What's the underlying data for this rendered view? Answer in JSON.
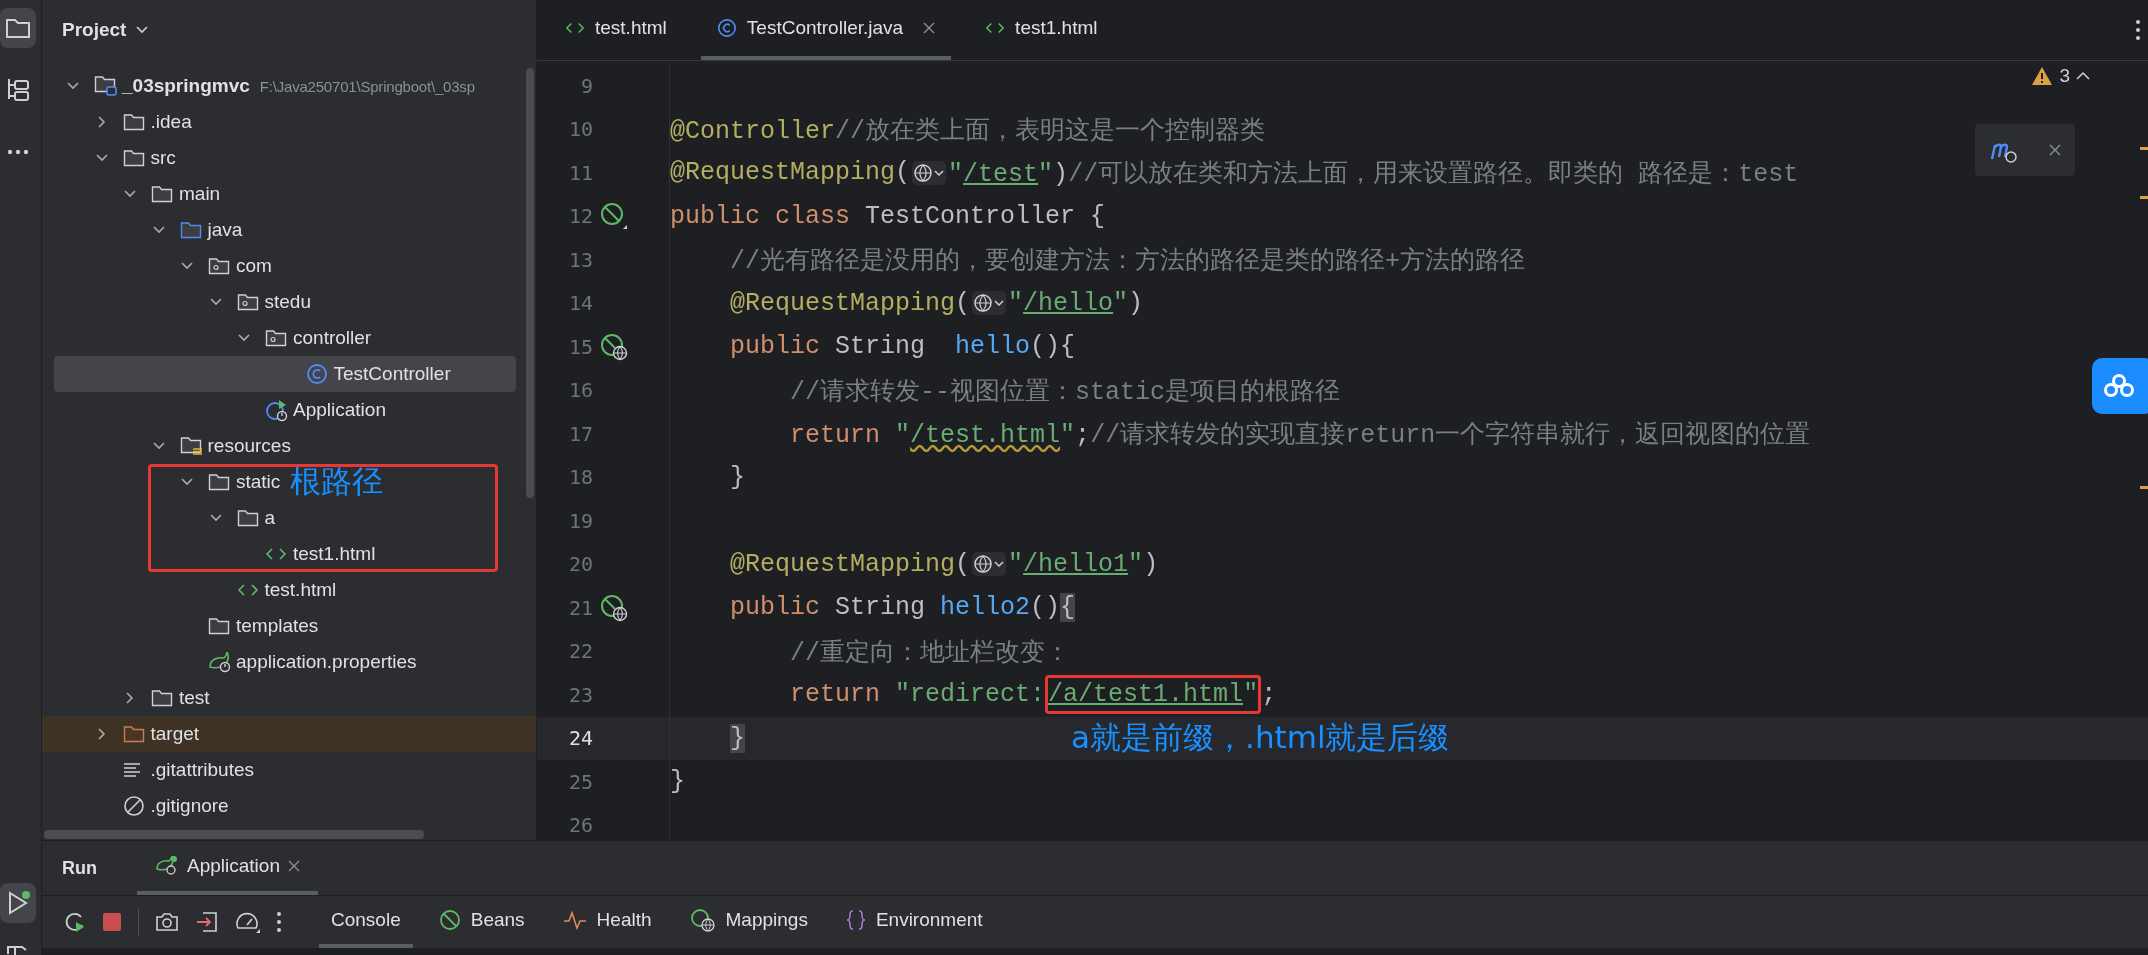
{
  "tool_strip": [
    {
      "kind": "project",
      "selected": true
    },
    {
      "kind": "structure",
      "selected": false
    },
    {
      "kind": "more",
      "selected": false
    }
  ],
  "tool_strip_bottom": [
    {
      "kind": "run",
      "selected": true
    },
    {
      "kind": "build",
      "selected": false
    }
  ],
  "project_panel": {
    "title": "Project",
    "tree": [
      {
        "kind": "module",
        "name": "_03springmvc",
        "path": "F:\\Java250701\\Springboot\\_03sp",
        "expanded": true,
        "selected": false,
        "children": [
          {
            "kind": "folder",
            "name": ".idea",
            "expanded": false,
            "selected": false
          },
          {
            "kind": "folder",
            "name": "src",
            "expanded": true,
            "selected": false,
            "children": [
              {
                "kind": "folder",
                "name": "main",
                "expanded": true,
                "selected": false,
                "children": [
                  {
                    "kind": "source",
                    "name": "java",
                    "expanded": true,
                    "selected": false,
                    "children": [
                      {
                        "kind": "package",
                        "name": "com",
                        "expanded": true,
                        "selected": false,
                        "children": [
                          {
                            "kind": "package",
                            "name": "stedu",
                            "expanded": true,
                            "selected": false,
                            "children": [
                              {
                                "kind": "package",
                                "name": "controller",
                                "expanded": true,
                                "selected": false,
                                "children": [
                                  {
                                    "kind": "class",
                                    "name": "TestController",
                                    "selected": true
                                  }
                                ]
                              },
                              {
                                "kind": "spring-app",
                                "name": "Application",
                                "selected": false
                              }
                            ]
                          }
                        ]
                      }
                    ]
                  },
                  {
                    "kind": "resources",
                    "name": "resources",
                    "expanded": true,
                    "selected": false,
                    "children": [
                      {
                        "kind": "folder",
                        "name": "static",
                        "expanded": true,
                        "selected": false,
                        "boxed": true,
                        "note": "根路径",
                        "children": [
                          {
                            "kind": "folder",
                            "name": "a",
                            "expanded": true,
                            "selected": false,
                            "boxed": true,
                            "children": [
                              {
                                "kind": "html",
                                "name": "test1.html",
                                "selected": false,
                                "boxed": true
                              }
                            ]
                          },
                          {
                            "kind": "html",
                            "name": "test.html",
                            "selected": false
                          }
                        ]
                      },
                      {
                        "kind": "folder",
                        "name": "templates",
                        "selected": false
                      },
                      {
                        "kind": "spring-props",
                        "name": "application.properties",
                        "selected": false
                      }
                    ]
                  }
                ]
              },
              {
                "kind": "folder",
                "name": "test",
                "expanded": false,
                "selected": false
              }
            ]
          },
          {
            "kind": "excluded",
            "name": "target",
            "expanded": false,
            "selected": false
          },
          {
            "kind": "lines",
            "name": ".gitattributes",
            "selected": false
          },
          {
            "kind": "ignore",
            "name": ".gitignore",
            "selected": false
          }
        ]
      }
    ]
  },
  "editor": {
    "tabs": [
      {
        "kind": "html",
        "label": "test.html",
        "selected": false
      },
      {
        "kind": "class",
        "label": "TestController.java",
        "selected": true
      },
      {
        "kind": "html",
        "label": "test1.html",
        "selected": false
      }
    ],
    "warnings": "3",
    "lines": [
      {
        "number": "9"
      },
      {
        "number": "10",
        "tokens": [
          {
            "kind": "annotation",
            "text": "@Controller"
          },
          {
            "kind": "comment",
            "text": "//放在类上面，表明这是一个控制器类"
          }
        ]
      },
      {
        "number": "11",
        "tokens": [
          {
            "kind": "annotation",
            "text": "@RequestMapping"
          },
          {
            "kind": "plain",
            "text": "("
          },
          {
            "kind": "inlay"
          },
          {
            "kind": "string",
            "text": "\""
          },
          {
            "kind": "url",
            "text": "/test"
          },
          {
            "kind": "string",
            "text": "\""
          },
          {
            "kind": "plain",
            "text": ")"
          },
          {
            "kind": "comment",
            "text": "//可以放在类和方法上面，用来设置路径。即类的 路径是：test"
          }
        ]
      },
      {
        "number": "12",
        "kind": "bean",
        "tokens": [
          {
            "kind": "keyword",
            "text": "public class "
          },
          {
            "kind": "plain",
            "text": "TestController {"
          }
        ]
      },
      {
        "number": "13",
        "tokens": [
          {
            "kind": "comment",
            "text": "    //光有路径是没用的，要创建方法：方法的路径是类的路径+方法的路径"
          }
        ]
      },
      {
        "number": "14",
        "tokens": [
          {
            "kind": "annotation",
            "text": "    @RequestMapping"
          },
          {
            "kind": "plain",
            "text": "("
          },
          {
            "kind": "inlay"
          },
          {
            "kind": "string",
            "text": "\""
          },
          {
            "kind": "url",
            "text": "/hello"
          },
          {
            "kind": "string",
            "text": "\""
          },
          {
            "kind": "plain",
            "text": ")"
          }
        ]
      },
      {
        "number": "15",
        "kind": "endpoint",
        "tokens": [
          {
            "kind": "keyword",
            "text": "    public "
          },
          {
            "kind": "plain",
            "text": "String  "
          },
          {
            "kind": "method",
            "text": "hello"
          },
          {
            "kind": "plain",
            "text": "(){"
          }
        ]
      },
      {
        "number": "16",
        "tokens": [
          {
            "kind": "comment",
            "text": "        //请求转发--视图位置：static是项目的根路径"
          }
        ]
      },
      {
        "number": "17",
        "tokens": [
          {
            "kind": "keyword",
            "text": "        return "
          },
          {
            "kind": "string",
            "text": "\""
          },
          {
            "kind": "warn",
            "text": "/test.html"
          },
          {
            "kind": "string",
            "text": "\""
          },
          {
            "kind": "plain",
            "text": ";"
          },
          {
            "kind": "comment",
            "text": "//请求转发的实现直接return一个字符串就行，返回视图的位置"
          }
        ]
      },
      {
        "number": "18",
        "tokens": [
          {
            "kind": "plain",
            "text": "    }"
          }
        ]
      },
      {
        "number": "19"
      },
      {
        "number": "20",
        "tokens": [
          {
            "kind": "annotation",
            "text": "    @RequestMapping"
          },
          {
            "kind": "plain",
            "text": "("
          },
          {
            "kind": "inlay"
          },
          {
            "kind": "string",
            "text": "\""
          },
          {
            "kind": "url",
            "text": "/hello1"
          },
          {
            "kind": "string",
            "text": "\""
          },
          {
            "kind": "plain",
            "text": ")"
          }
        ]
      },
      {
        "number": "21",
        "kind": "endpoint",
        "tokens": [
          {
            "kind": "keyword",
            "text": "    public "
          },
          {
            "kind": "plain",
            "text": "String "
          },
          {
            "kind": "method",
            "text": "hello2"
          },
          {
            "kind": "plain",
            "text": "()"
          },
          {
            "kind": "brace",
            "text": "{"
          }
        ]
      },
      {
        "number": "22",
        "tokens": [
          {
            "kind": "comment",
            "text": "        //重定向：地址栏改变："
          }
        ]
      },
      {
        "number": "23",
        "tokens": [
          {
            "kind": "keyword",
            "text": "        return "
          },
          {
            "kind": "string",
            "text": "\"redirect:"
          },
          {
            "kind": "url",
            "text": "/a/test1.html",
            "boxed": true
          },
          {
            "kind": "string",
            "text": "\"",
            "boxed": true
          },
          {
            "kind": "plain",
            "text": ";"
          }
        ]
      },
      {
        "number": "24",
        "current": true,
        "note": "a就是前缀，.html就是后缀",
        "tokens": [
          {
            "kind": "brace",
            "text": "    }"
          }
        ]
      },
      {
        "number": "25",
        "tokens": [
          {
            "kind": "plain",
            "text": "}"
          }
        ]
      },
      {
        "number": "26"
      }
    ]
  },
  "run_panel": {
    "title": "Run",
    "tabs": [
      {
        "label": "Application",
        "selected": true
      }
    ],
    "views": [
      {
        "kind": "console",
        "label": "Console",
        "selected": true
      },
      {
        "kind": "beans",
        "label": "Beans",
        "selected": false
      },
      {
        "kind": "health",
        "label": "Health",
        "selected": false
      },
      {
        "kind": "mappings",
        "label": "Mappings",
        "selected": false
      },
      {
        "kind": "environment",
        "label": "Environment",
        "selected": false
      }
    ]
  }
}
